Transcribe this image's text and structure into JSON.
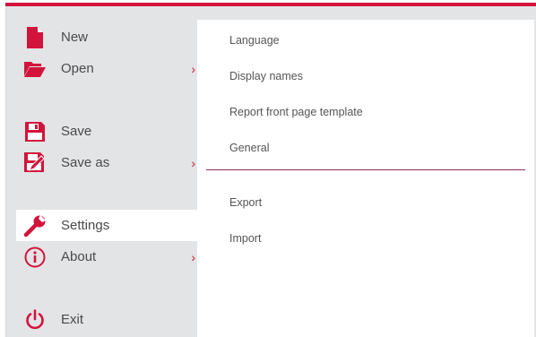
{
  "sidebar": {
    "items": [
      {
        "label": "New",
        "icon": "new-document-icon"
      },
      {
        "label": "Open",
        "icon": "folder-open-icon",
        "has_submenu": true
      },
      {
        "label": "Save",
        "icon": "floppy-disk-icon"
      },
      {
        "label": "Save as",
        "icon": "floppy-disk-pencil-icon",
        "has_submenu": true
      },
      {
        "label": "Settings",
        "icon": "wrench-icon",
        "active": true
      },
      {
        "label": "About",
        "icon": "info-icon",
        "has_submenu": true
      },
      {
        "label": "Exit",
        "icon": "power-icon"
      }
    ]
  },
  "submenu": {
    "items": [
      {
        "label": "Language"
      },
      {
        "label": "Display names"
      },
      {
        "label": "Report front page template"
      },
      {
        "label": "General"
      },
      {
        "label": "Export"
      },
      {
        "label": "Import"
      }
    ]
  },
  "colors": {
    "accent": "#d2143c",
    "divider": "#8e2a6e",
    "sidebar_bg": "#e3e4e6",
    "panel_bg": "#ffffff",
    "text": "#4a4a4a"
  }
}
